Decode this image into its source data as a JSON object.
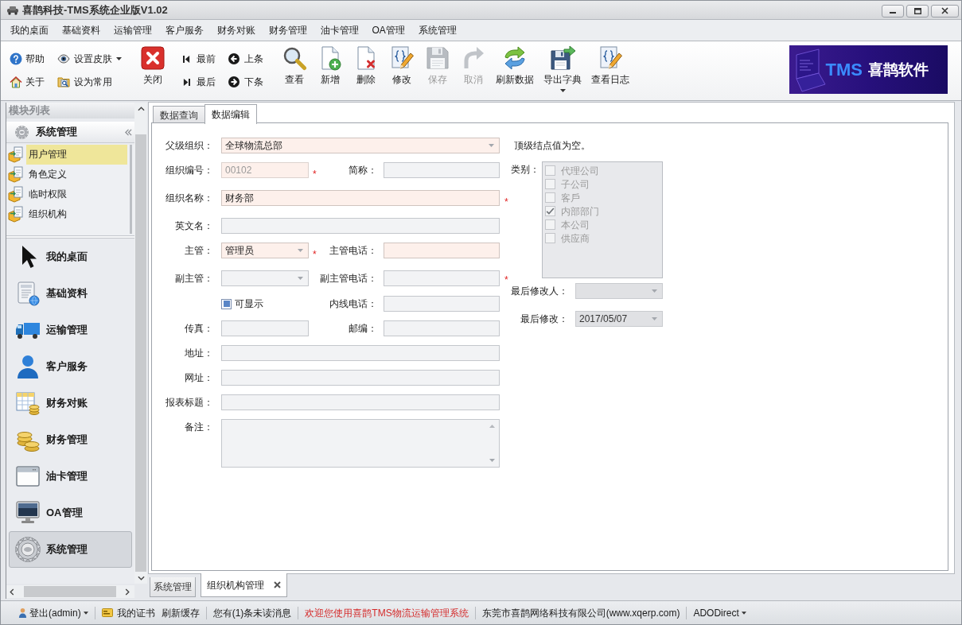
{
  "window": {
    "title": "喜鹊科技-TMS系统企业版V1.02"
  },
  "menu": [
    "我的桌面",
    "基础资料",
    "运输管理",
    "客户服务",
    "财务对账",
    "财务管理",
    "油卡管理",
    "OA管理",
    "系统管理"
  ],
  "toolbar": {
    "groups": [
      {
        "kind": "stack",
        "items": [
          {
            "label": "帮助",
            "dropdown": false
          },
          {
            "label": "关于",
            "dropdown": false
          }
        ]
      },
      {
        "kind": "stack",
        "items": [
          {
            "label": "设置皮肤",
            "dropdown": true
          },
          {
            "label": "设为常用",
            "dropdown": false
          }
        ]
      },
      {
        "kind": "large",
        "items": [
          {
            "label": "关闭",
            "disabled": false,
            "dropdown": false
          }
        ]
      },
      {
        "kind": "stack",
        "items": [
          {
            "label": "最前",
            "dropdown": false
          },
          {
            "label": "最后",
            "dropdown": false
          }
        ]
      },
      {
        "kind": "stack",
        "items": [
          {
            "label": "上条",
            "dropdown": false
          },
          {
            "label": "下条",
            "dropdown": false
          }
        ]
      },
      {
        "kind": "large",
        "items": [
          {
            "label": "查看",
            "disabled": false,
            "dropdown": false
          },
          {
            "label": "新增",
            "disabled": false,
            "dropdown": false
          },
          {
            "label": "删除",
            "disabled": false,
            "dropdown": false
          },
          {
            "label": "修改",
            "disabled": false,
            "dropdown": false
          },
          {
            "label": "保存",
            "disabled": true,
            "dropdown": false
          },
          {
            "label": "取消",
            "disabled": true,
            "dropdown": false
          },
          {
            "label": "刷新数据",
            "disabled": false,
            "dropdown": false
          },
          {
            "label": "导出字典",
            "disabled": false,
            "dropdown": true
          },
          {
            "label": "查看日志",
            "disabled": false,
            "dropdown": false
          }
        ]
      }
    ],
    "banner": {
      "brand": "TMS",
      "name": "喜鹊软件"
    }
  },
  "sidebar": {
    "title": "模块列表",
    "section": "系统管理",
    "items": [
      {
        "label": "用户管理",
        "selected": true
      },
      {
        "label": "角色定义",
        "selected": false
      },
      {
        "label": "临时权限",
        "selected": false
      },
      {
        "label": "组织机构",
        "selected": false
      }
    ],
    "nav": [
      {
        "label": "我的桌面",
        "selected": false
      },
      {
        "label": "基础资料",
        "selected": false
      },
      {
        "label": "运输管理",
        "selected": false
      },
      {
        "label": "客户服务",
        "selected": false
      },
      {
        "label": "财务对账",
        "selected": false
      },
      {
        "label": "财务管理",
        "selected": false
      },
      {
        "label": "油卡管理",
        "selected": false
      },
      {
        "label": "OA管理",
        "selected": false
      },
      {
        "label": "系统管理",
        "selected": true
      }
    ]
  },
  "tabs": [
    {
      "label": "数据查询",
      "selected": false
    },
    {
      "label": "数据编辑",
      "selected": true
    }
  ],
  "form": {
    "rows": [
      {
        "fields": [
          {
            "label": "父级组织：",
            "kind": "combo",
            "value": "全球物流总部",
            "highlighted": true,
            "disabled": false
          }
        ]
      },
      {
        "fields": [
          {
            "label": "组织编号：",
            "kind": "text",
            "value": "00102",
            "highlighted": true,
            "disabled": true,
            "mark": "*"
          },
          {
            "label": "简称：",
            "kind": "text",
            "highlighted": false,
            "disabled": false
          }
        ]
      },
      {
        "fields": [
          {
            "label": "组织名称：",
            "kind": "text",
            "value": "财务部",
            "highlighted": true,
            "disabled": false,
            "mark": "*"
          }
        ]
      },
      {
        "fields": [
          {
            "label": "英文名：",
            "kind": "text",
            "highlighted": false,
            "disabled": false
          }
        ]
      },
      {
        "fields": [
          {
            "label": "主管：",
            "kind": "combo",
            "value": "管理员",
            "highlighted": true,
            "disabled": false,
            "mark": "*"
          },
          {
            "label": "主管电话：",
            "kind": "text",
            "highlighted": true,
            "disabled": false
          }
        ]
      },
      {
        "fields": [
          {
            "label": "副主管：",
            "kind": "combo",
            "highlighted": false,
            "disabled": false
          },
          {
            "label": "副主管电话：",
            "kind": "text",
            "highlighted": false,
            "disabled": false,
            "mark": "*"
          }
        ]
      },
      {
        "fields": [
          {
            "label": "可显示",
            "kind": "checkbox",
            "checked": true
          },
          {
            "label": "内线电话：",
            "kind": "text",
            "highlighted": false,
            "disabled": false
          }
        ]
      },
      {
        "fields": [
          {
            "label": "传真：",
            "kind": "text",
            "highlighted": false,
            "disabled": false
          },
          {
            "label": "邮编：",
            "kind": "text",
            "highlighted": false,
            "disabled": false
          }
        ]
      },
      {
        "fields": [
          {
            "label": "地址：",
            "kind": "text",
            "highlighted": false,
            "disabled": false
          }
        ]
      },
      {
        "fields": [
          {
            "label": "网址：",
            "kind": "text",
            "highlighted": false,
            "disabled": false
          }
        ]
      },
      {
        "fields": [
          {
            "label": "报表标题：",
            "kind": "text",
            "highlighted": false,
            "disabled": false
          }
        ]
      },
      {
        "fields": [
          {
            "label": "备注：",
            "kind": "textarea",
            "highlighted": false,
            "disabled": false
          }
        ]
      }
    ],
    "note": "顶级结点值为空。",
    "category": {
      "label": "类别：",
      "disabled": true,
      "options": [
        {
          "label": "代理公司",
          "checked": false
        },
        {
          "label": "子公司",
          "checked": false
        },
        {
          "label": "客戶",
          "checked": false
        },
        {
          "label": "内部部门",
          "checked": true
        },
        {
          "label": "本公司",
          "checked": false
        },
        {
          "label": "供应商",
          "checked": false
        }
      ]
    },
    "modified_by": {
      "label": "最后修改人：",
      "disabled": true
    },
    "modified_at": {
      "label": "最后修改：",
      "value": "2017/05/07",
      "disabled": true
    }
  },
  "document_tabs": [
    {
      "label": "系统管理",
      "selected": false,
      "closable": false
    },
    {
      "label": "组织机构管理",
      "selected": true,
      "closable": true
    }
  ],
  "status_bar": [
    {
      "label": "登出(admin)",
      "kind": "plain",
      "dropdown": true
    },
    {
      "label": "我的证书",
      "kind": "plain",
      "dropdown": false
    },
    {
      "label": "刷新缓存",
      "kind": "plain",
      "dropdown": false
    },
    {
      "label": "您有(1)条未读消息",
      "kind": "plain",
      "dropdown": false
    },
    {
      "label": "欢迎您使用喜鹊TMS物流运输管理系统",
      "kind": "notice",
      "dropdown": false
    },
    {
      "label": "东莞市喜鹊网络科技有限公司(www.xqerp.com)",
      "kind": "plain",
      "dropdown": false
    },
    {
      "label": "ADODirect",
      "kind": "plain",
      "dropdown": true
    }
  ]
}
